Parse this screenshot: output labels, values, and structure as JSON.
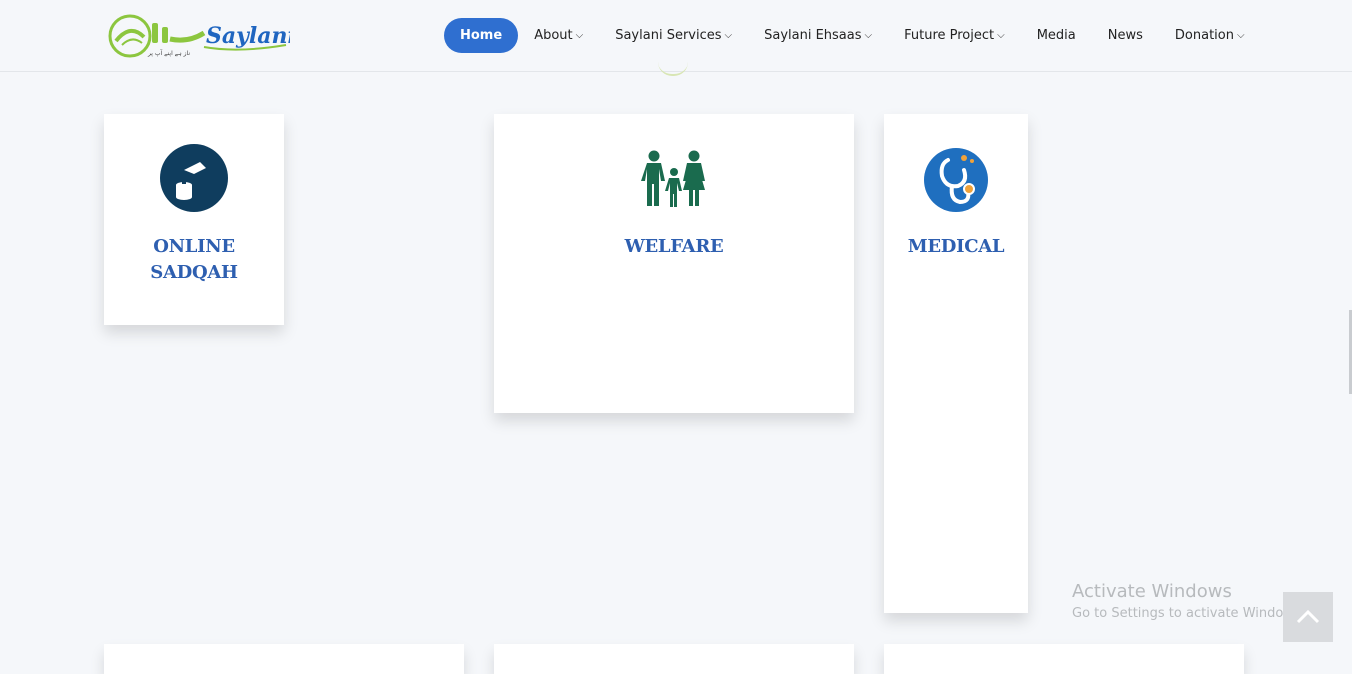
{
  "header": {
    "logo": {
      "text": "Saylani",
      "tagline": "ناز ہے اپنے آپ پر",
      "icon": "saylani-logo"
    },
    "nav": [
      {
        "label": "Home",
        "active": true,
        "dropdown": false
      },
      {
        "label": "About",
        "dropdown": true
      },
      {
        "label": "Saylani Services",
        "dropdown": true
      },
      {
        "label": "Saylani Ehsaas",
        "dropdown": true
      },
      {
        "label": "Future Project",
        "dropdown": true
      },
      {
        "label": "Media",
        "dropdown": false
      },
      {
        "label": "News",
        "dropdown": false
      },
      {
        "label": "Donation",
        "dropdown": true
      }
    ]
  },
  "cards": [
    {
      "title_line1": "ONLINE",
      "title_line2": "SADQAH",
      "icon": "donation-box-icon"
    },
    {
      "title": "WELFARE",
      "icon": "family-icon"
    },
    {
      "title": "MEDICAL",
      "icon": "stethoscope-icon"
    }
  ],
  "windows_watermark": {
    "title": "Activate Windows",
    "subtitle": "Go to Settings to activate Windows."
  },
  "colors": {
    "accent": "#2f6fd0",
    "card_title": "#2e5fb0",
    "welfare_green": "#1a6b4e",
    "sadqah_navy": "#0f3d5e",
    "medical_blue": "#1f6fbf"
  }
}
